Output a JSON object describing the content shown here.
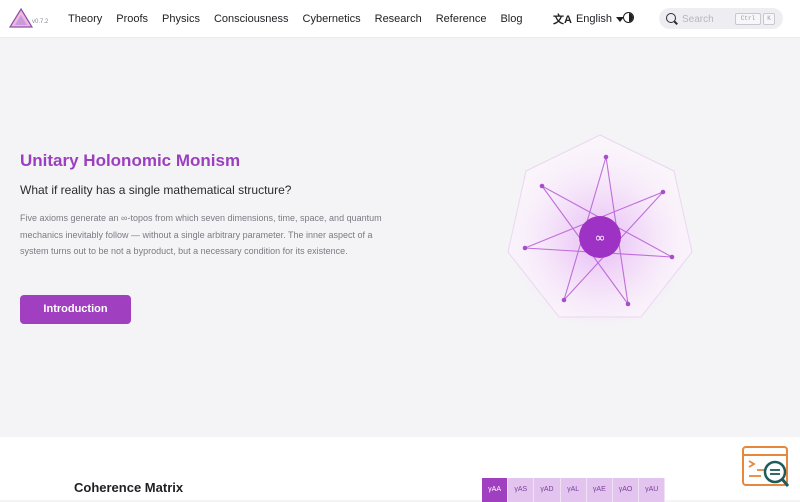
{
  "brand": {
    "version": "v0.7.2"
  },
  "nav": {
    "links": [
      "Theory",
      "Proofs",
      "Physics",
      "Consciousness",
      "Cybernetics",
      "Research",
      "Reference",
      "Blog"
    ],
    "language": "English",
    "language_icon": "translate-icon",
    "theme_icon": "contrast-icon",
    "search": {
      "placeholder": "Search",
      "shortcut_mod": "Ctrl",
      "shortcut_key": "K"
    }
  },
  "hero": {
    "title": "Unitary Holonomic Monism",
    "subtitle": "What if reality has a single mathematical structure?",
    "body": "Five axioms generate an ∞-topos from which seven dimensions, time, space, and quantum mechanics inevitably follow — without a single arbitrary parameter. The inner aspect of a system turns out to be not a byproduct, but a necessary condition for its existence.",
    "cta": "Introduction",
    "graphic_symbol": "∞"
  },
  "coherence": {
    "title": "Coherence Matrix",
    "tabs": [
      "γAA",
      "γAS",
      "γAD",
      "γAL",
      "γAE",
      "γAO",
      "γAU"
    ],
    "active_tab": "γAA"
  },
  "colors": {
    "accent": "#a040c0",
    "title": "#9b3fc0",
    "helper_orange": "#e8873a",
    "helper_teal": "#1f5a5c"
  }
}
